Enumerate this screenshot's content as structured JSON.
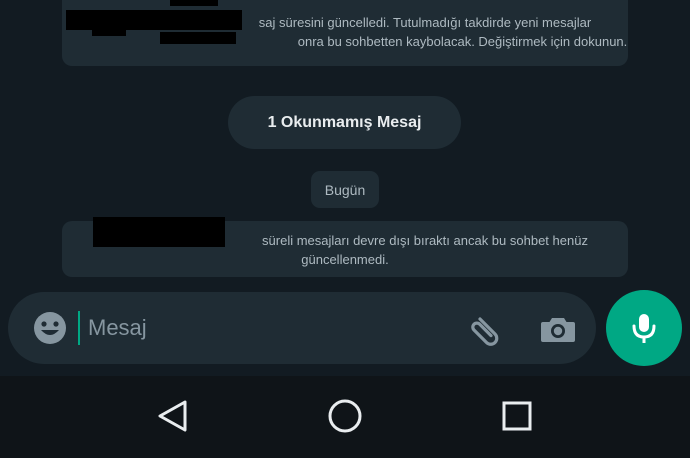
{
  "system_messages": {
    "top": {
      "line1": "saj süresini güncelledi. Tutulmadığı takdirde yeni mesajlar",
      "line2": "onra bu sohbetten kaybolacak. Değiştirmek için dokunun."
    },
    "bottom": {
      "line1": "süreli mesajları devre dışı bıraktı ancak bu sohbet henüz",
      "line2": "güncellenmedi."
    }
  },
  "unread_banner": "1 Okunmamış Mesaj",
  "date_label": "Bugün",
  "composer": {
    "placeholder": "Mesaj",
    "emoji_icon": "emoji-icon",
    "attach_icon": "paperclip-icon",
    "camera_icon": "camera-icon",
    "mic_icon": "microphone-icon"
  },
  "navigation": {
    "back_icon": "back-triangle-icon",
    "home_icon": "home-circle-icon",
    "recents_icon": "recents-square-icon"
  },
  "colors": {
    "background": "#121b22",
    "bubble": "#1f2c34",
    "accent": "#00a884",
    "text_muted": "#aebac1"
  }
}
